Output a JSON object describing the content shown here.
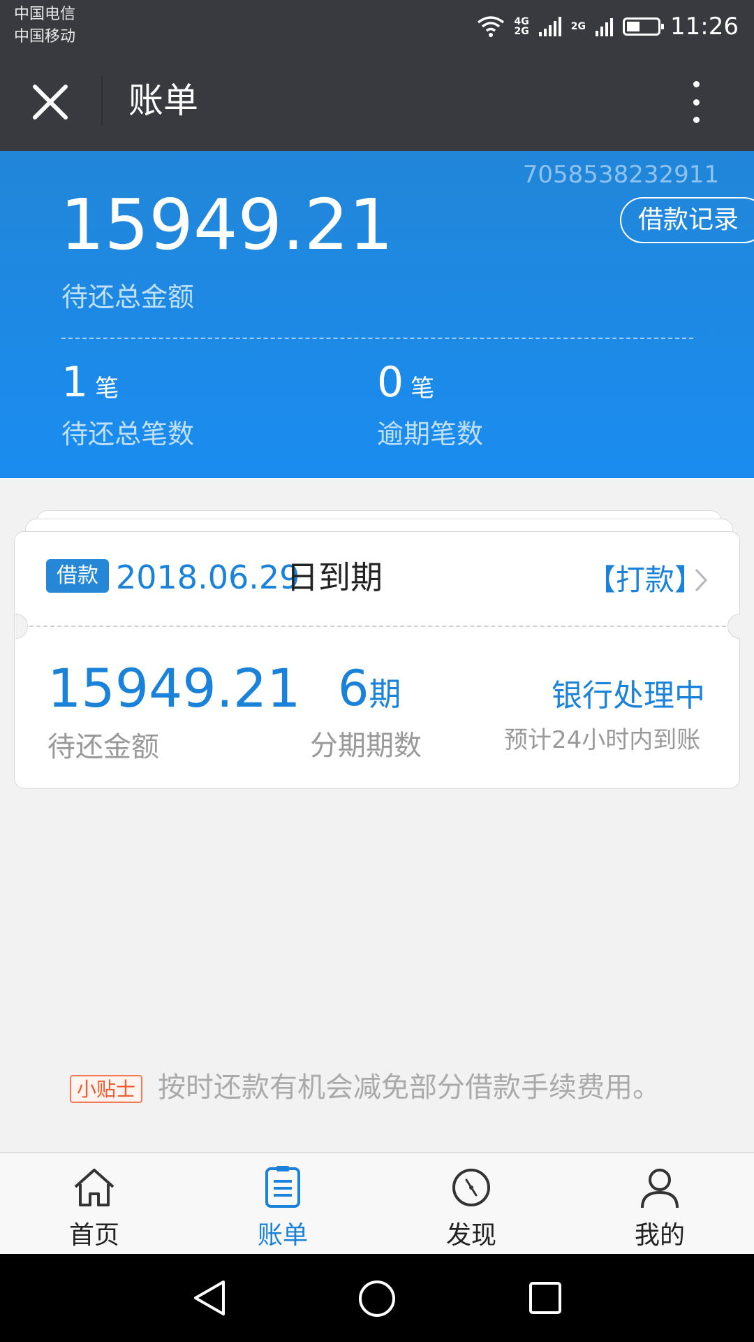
{
  "status_bar": {
    "carrier1": "中国电信",
    "carrier2": "中国移动",
    "net1_top": "4G",
    "net1_bottom": "2G",
    "net2": "2G",
    "time": "11:26"
  },
  "header": {
    "title": "账单"
  },
  "summary": {
    "account_no": "7058538232911",
    "loan_record_label": "借款记录",
    "total_amount": "15949.21",
    "total_label": "待还总金额",
    "pending_count": "1",
    "pending_unit": "笔",
    "pending_label": "待还总笔数",
    "overdue_count": "0",
    "overdue_unit": "笔",
    "overdue_label": "逾期笔数"
  },
  "bill_card": {
    "tag": "借款",
    "due_date": "2018.06.29",
    "due_suffix": "日到期",
    "action": "【打款】",
    "amount": "15949.21",
    "amount_label": "待还金额",
    "periods": "6",
    "periods_unit": "期",
    "periods_label": "分期期数",
    "status": "银行处理中",
    "status_note": "预计24小时内到账"
  },
  "tip": {
    "tag": "小贴士",
    "text": "按时还款有机会减免部分借款手续费用。"
  },
  "bottom_nav": {
    "items": [
      {
        "label": "首页",
        "icon": "home-icon"
      },
      {
        "label": "账单",
        "icon": "bill-icon",
        "active": true
      },
      {
        "label": "发现",
        "icon": "compass-icon"
      },
      {
        "label": "我的",
        "icon": "user-icon"
      }
    ]
  },
  "colors": {
    "accent": "#1a82d8",
    "header_bg": "#393a3f",
    "tip_accent": "#f05a2e"
  }
}
